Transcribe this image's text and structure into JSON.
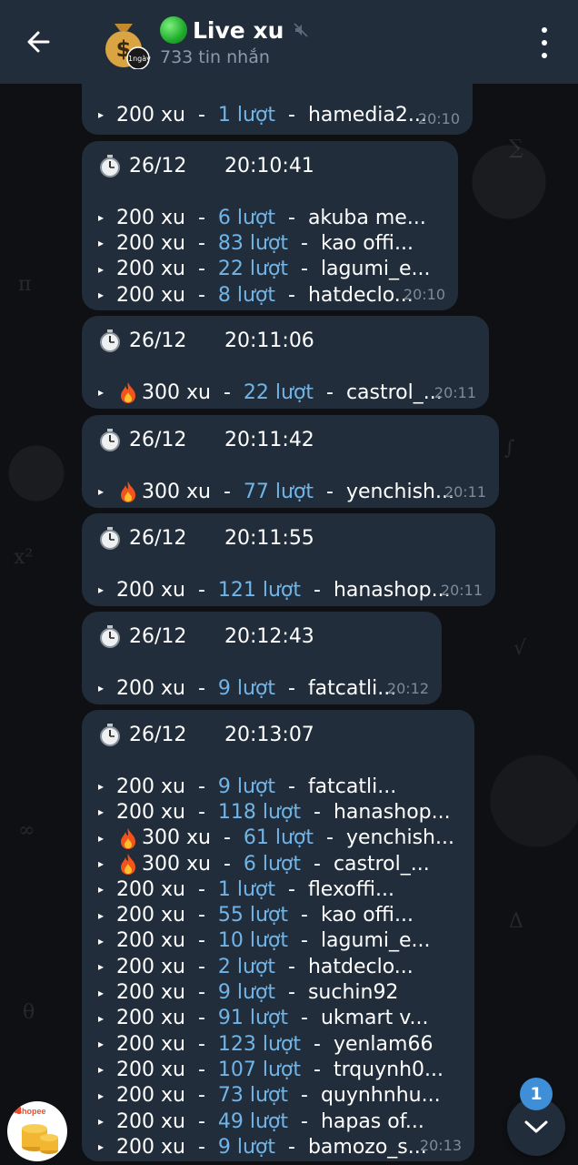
{
  "header": {
    "title": "Live xu",
    "subtitle": "733 tin nhắn",
    "avatar_badge": "1ngày"
  },
  "messages": [
    {
      "date": "",
      "time_head": "",
      "lines": [
        {
          "fire": false,
          "xu": "200 xu",
          "count": "1 lượt",
          "shop": "hamedia2..."
        }
      ],
      "stamp": "20:10"
    },
    {
      "date": "26/12",
      "time_head": "20:10:41",
      "lines": [
        {
          "fire": false,
          "xu": "200 xu",
          "count": "6 lượt",
          "shop": "akuba me..."
        },
        {
          "fire": false,
          "xu": "200 xu",
          "count": "83 lượt",
          "shop": "kao offi..."
        },
        {
          "fire": false,
          "xu": "200 xu",
          "count": "22 lượt",
          "shop": "lagumi_e..."
        },
        {
          "fire": false,
          "xu": "200 xu",
          "count": "8 lượt",
          "shop": "hatdeclo..."
        }
      ],
      "stamp": "20:10"
    },
    {
      "date": "26/12",
      "time_head": "20:11:06",
      "lines": [
        {
          "fire": true,
          "xu": "300 xu",
          "count": "22 lượt",
          "shop": "castrol_..."
        }
      ],
      "stamp": "20:11"
    },
    {
      "date": "26/12",
      "time_head": "20:11:42",
      "lines": [
        {
          "fire": true,
          "xu": "300 xu",
          "count": "77 lượt",
          "shop": "yenchish..."
        }
      ],
      "stamp": "20:11"
    },
    {
      "date": "26/12",
      "time_head": "20:11:55",
      "lines": [
        {
          "fire": false,
          "xu": "200 xu",
          "count": "121 lượt",
          "shop": "hanashop..."
        }
      ],
      "stamp": "20:11"
    },
    {
      "date": "26/12",
      "time_head": "20:12:43",
      "lines": [
        {
          "fire": false,
          "xu": "200 xu",
          "count": "9 lượt",
          "shop": "fatcatli..."
        }
      ],
      "stamp": "20:12"
    },
    {
      "date": "26/12",
      "time_head": "20:13:07",
      "lines": [
        {
          "fire": false,
          "xu": "200 xu",
          "count": "9 lượt",
          "shop": "fatcatli..."
        },
        {
          "fire": false,
          "xu": "200 xu",
          "count": "118 lượt",
          "shop": "hanashop..."
        },
        {
          "fire": true,
          "xu": "300 xu",
          "count": "61 lượt",
          "shop": "yenchish..."
        },
        {
          "fire": true,
          "xu": "300 xu",
          "count": "6 lượt",
          "shop": "castrol_..."
        },
        {
          "fire": false,
          "xu": "200 xu",
          "count": "1 lượt",
          "shop": "flexoffi..."
        },
        {
          "fire": false,
          "xu": "200 xu",
          "count": "55 lượt",
          "shop": "kao offi..."
        },
        {
          "fire": false,
          "xu": "200 xu",
          "count": "10 lượt",
          "shop": "lagumi_e..."
        },
        {
          "fire": false,
          "xu": "200 xu",
          "count": "2 lượt",
          "shop": "hatdeclo..."
        },
        {
          "fire": false,
          "xu": "200 xu",
          "count": "9 lượt",
          "shop": "suchin92"
        },
        {
          "fire": false,
          "xu": "200 xu",
          "count": "91 lượt",
          "shop": "ukmart v..."
        },
        {
          "fire": false,
          "xu": "200 xu",
          "count": "123 lượt",
          "shop": "yenlam66"
        },
        {
          "fire": false,
          "xu": "200 xu",
          "count": "107 lượt",
          "shop": "trquynh0..."
        },
        {
          "fire": false,
          "xu": "200 xu",
          "count": "73 lượt",
          "shop": "quynhnhu..."
        },
        {
          "fire": false,
          "xu": "200 xu",
          "count": "49 lượt",
          "shop": "hapas of..."
        },
        {
          "fire": false,
          "xu": "200 xu",
          "count": "9 lượt",
          "shop": "bamozo_s..."
        }
      ],
      "stamp": "20:13"
    }
  ],
  "floating": {
    "unread_badge": "1",
    "shopee_label": "Shopee"
  },
  "colors": {
    "header_bg": "#212d3b",
    "bubble_bg": "#212d3b",
    "link_blue": "#71b5e8",
    "timestamp_gray": "#7d8b99",
    "badge_blue": "#3e8fd8"
  }
}
